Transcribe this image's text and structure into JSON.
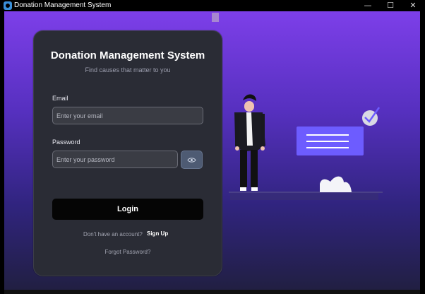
{
  "window": {
    "title": "Donation Management System",
    "controls": [
      "—",
      "☐",
      "✕"
    ]
  },
  "login": {
    "title": "Donation Management System",
    "subtitle": "Find causes that matter to you",
    "email_label": "Email",
    "email_placeholder": "Enter your email",
    "email_value": "",
    "password_label": "Password",
    "password_placeholder": "Enter your password",
    "password_value": "",
    "show_password_icon": "eye-icon",
    "login_button": "Login",
    "signup_prompt": "Don't have an account?",
    "signup_link": "Sign Up",
    "forgot_password": "Forgot Password?"
  },
  "colors": {
    "background_top": "#7d3fe9",
    "background_bottom": "#211f42",
    "card": "#2a2c35",
    "button": "#050505",
    "illustration_board": "#6d5cff"
  }
}
